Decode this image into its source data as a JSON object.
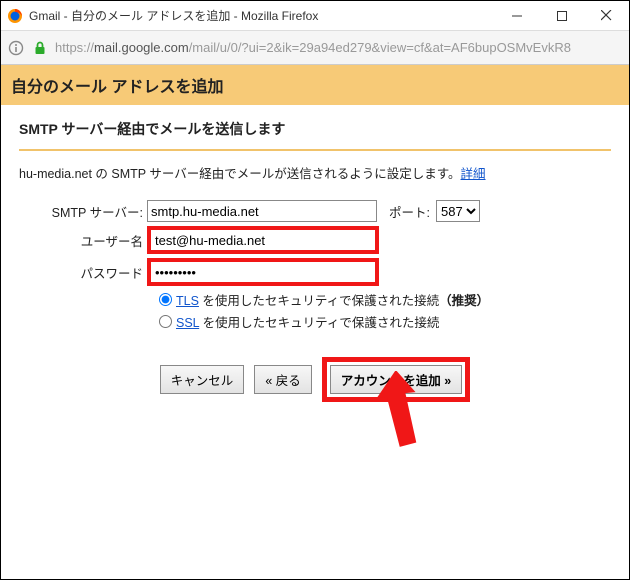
{
  "window": {
    "title": "Gmail - 自分のメール アドレスを追加 - Mozilla Firefox"
  },
  "addressbar": {
    "url_gray_prefix": "https://",
    "url_host": "mail.google.com",
    "url_rest": "/mail/u/0/?ui=2&ik=29a94ed279&view=cf&at=AF6bupOSMvEvkR8"
  },
  "header": {
    "title": "自分のメール アドレスを追加"
  },
  "section": {
    "title": "SMTP サーバー経由でメールを送信します",
    "desc_prefix": "hu-media.net の SMTP サーバー経由でメールが送信されるように設定します。",
    "desc_link": "詳細"
  },
  "form": {
    "smtp_label": "SMTP サーバー:",
    "smtp_value": "smtp.hu-media.net",
    "port_label": "ポート:",
    "port_value": "587",
    "user_label": "ユーザー名",
    "user_value": "test@hu-media.net",
    "pass_label": "パスワード",
    "pass_value": "•••••••••",
    "radio_tls_link": "TLS",
    "radio_tls_rest": " を使用したセキュリティで保護された接続",
    "radio_tls_bold": "（推奨）",
    "radio_ssl_link": "SSL",
    "radio_ssl_rest": " を使用したセキュリティで保護された接続"
  },
  "buttons": {
    "cancel": "キャンセル",
    "back": "« 戻る",
    "add": "アカウントを追加 »"
  }
}
